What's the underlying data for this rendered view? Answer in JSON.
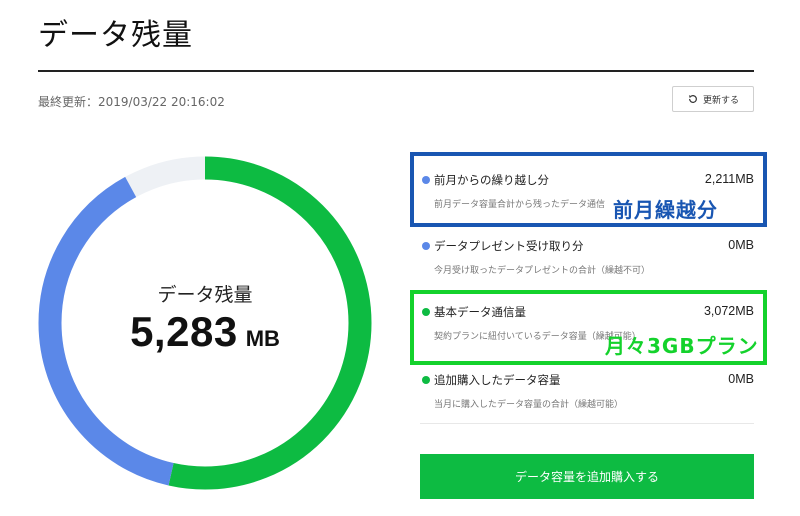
{
  "page": {
    "title": "データ残量",
    "last_updated": "最終更新：2019/03/22 20:16:02",
    "refresh_label": "更新する"
  },
  "summary": {
    "label": "データ残量",
    "value": "5,283",
    "unit": "MB"
  },
  "donut": {
    "total_mb": 5283,
    "segments": [
      {
        "name": "基本データ通信量",
        "value_mb": 3072,
        "color": "#0dbb42"
      },
      {
        "name": "前月からの繰り越し分",
        "value_mb": 2211,
        "color": "#5b88e8"
      }
    ],
    "remaining_fraction_shown": 0.92,
    "track_color": "#eef1f5"
  },
  "breakdown": [
    {
      "title": "前月からの繰り越し分",
      "amount": "2,211MB",
      "desc": "前月データ容量合計から残ったデータ通信",
      "dot_color": "#5b88e8"
    },
    {
      "title": "データプレゼント受け取り分",
      "amount": "0MB",
      "desc": "今月受け取ったデータプレゼントの合計（繰越不可）",
      "dot_color": "#5b88e8"
    },
    {
      "title": "基本データ通信量",
      "amount": "3,072MB",
      "desc": "契約プランに紐付いているデータ容量（繰越可能）",
      "dot_color": "#0dbb42"
    },
    {
      "title": "追加購入したデータ容量",
      "amount": "0MB",
      "desc": "当月に購入したデータ容量の合計（繰越可能）",
      "dot_color": "#0dbb42"
    }
  ],
  "annotations": {
    "carryover": "前月繰越分",
    "plan": "月々3GBプラン",
    "blue": "#1956b2",
    "green": "#14d22c"
  },
  "buy_button_label": "データ容量を追加購入する"
}
